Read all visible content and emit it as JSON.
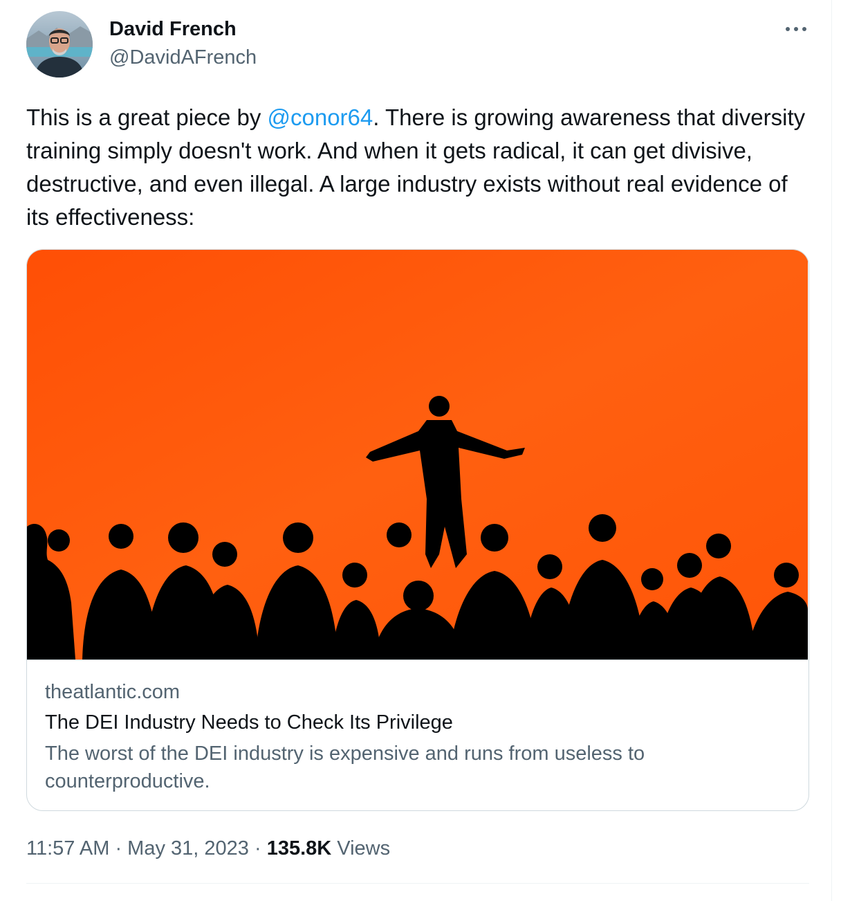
{
  "author": {
    "display_name": "David French",
    "handle": "@DavidAFrench",
    "avatar_icon": "profile-photo-avatar"
  },
  "menu": {
    "more_icon": "more-horizontal-icon"
  },
  "tweet": {
    "text_part1": "This is a great piece by ",
    "mention": "@conor64",
    "text_part2": ". There is growing awareness that diversity training simply doesn't work. And when it gets radical, it can get divisive, destructive, and even illegal. A large industry exists without real evidence of its effectiveness:"
  },
  "link_card": {
    "domain": "theatlantic.com",
    "title": "The DEI Industry Needs to Check Its Privilege",
    "description": "The worst of the DEI industry is expensive and runs from useless to counterproductive.",
    "image_icon": "speaker-silhouette-audience-image",
    "image_colors": {
      "background": "#ff5a0a",
      "silhouette": "#000000"
    }
  },
  "meta": {
    "time": "11:57 AM",
    "separator": " · ",
    "date": "May 31, 2023",
    "views_count": "135.8K",
    "views_label": "Views"
  },
  "colors": {
    "text_primary": "#0f1419",
    "text_secondary": "#536471",
    "link": "#1d9bf0",
    "border": "#cfd9de"
  }
}
